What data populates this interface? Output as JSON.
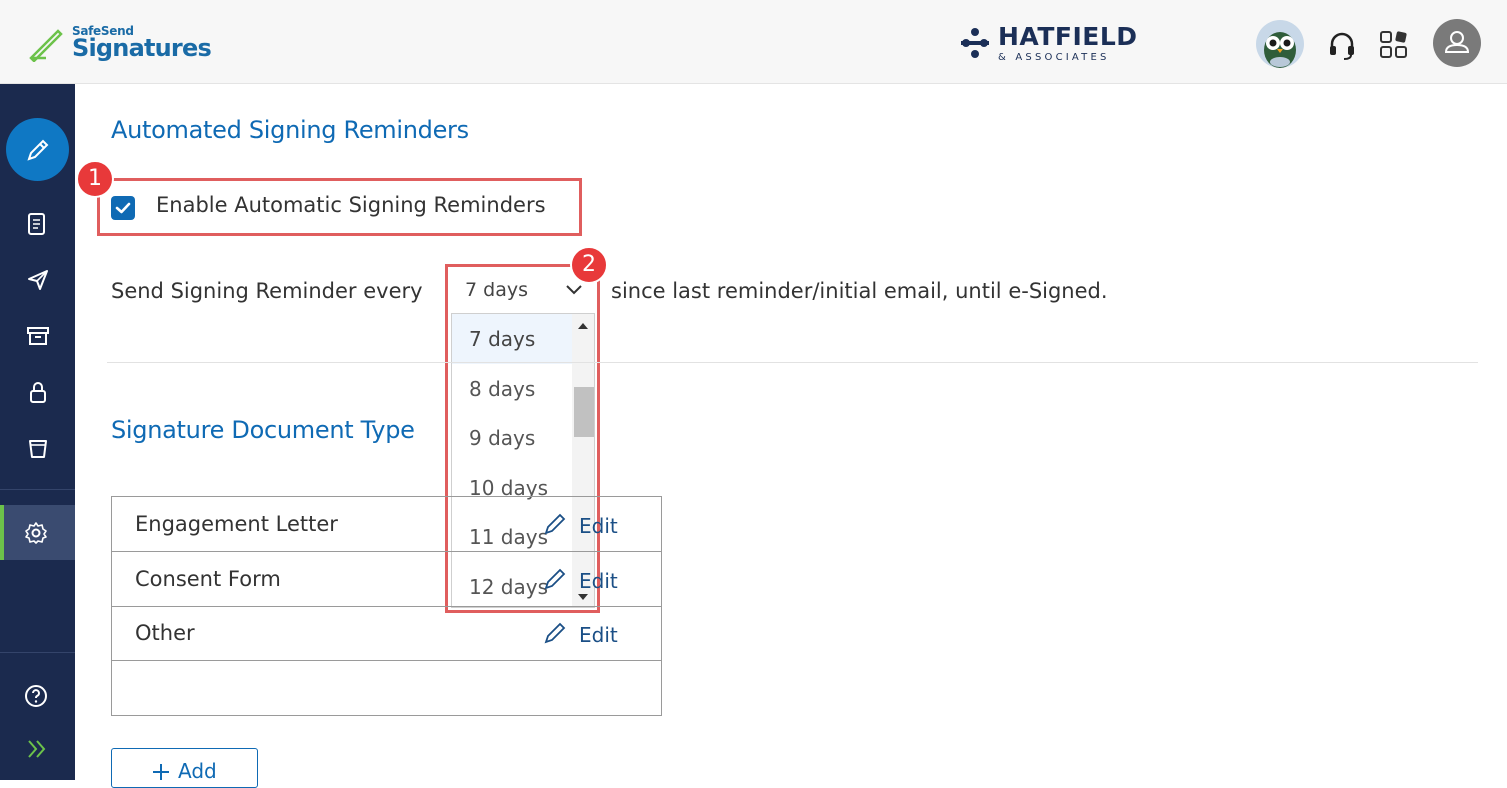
{
  "header": {
    "brand_small": "SafeSend",
    "brand_big": "Signatures",
    "firm_name": "HATFIELD",
    "firm_sub": "& ASSOCIATES"
  },
  "sidebar": {
    "items": [
      "pen-icon",
      "document-icon",
      "send-icon",
      "archive-icon",
      "lock-icon",
      "trash-icon",
      "settings-icon",
      "help-icon",
      "expand-icon"
    ],
    "active": "settings-icon"
  },
  "reminders": {
    "title": "Automated Signing Reminders",
    "enable_label": "Enable Automatic Signing Reminders",
    "enabled": true,
    "prefix": "Send Signing Reminder every",
    "selected": "7 days",
    "suffix": "since last reminder/initial email, until e-Signed.",
    "options": [
      "7 days",
      "8 days",
      "9 days",
      "10 days",
      "11 days",
      "12 days"
    ]
  },
  "annotations": {
    "badge1": "1",
    "badge2": "2"
  },
  "doc_types": {
    "title": "Signature Document Type",
    "rows": [
      {
        "name": "Engagement Letter",
        "edit": "Edit"
      },
      {
        "name": "Consent Form",
        "edit": "Edit"
      },
      {
        "name": "Other",
        "edit": "Edit"
      }
    ],
    "add_label": "Add"
  },
  "colors": {
    "accent": "#0f6ab4",
    "sidebar": "#1b2a4e",
    "highlight": "#e05e5e",
    "badge": "#e8393a"
  }
}
